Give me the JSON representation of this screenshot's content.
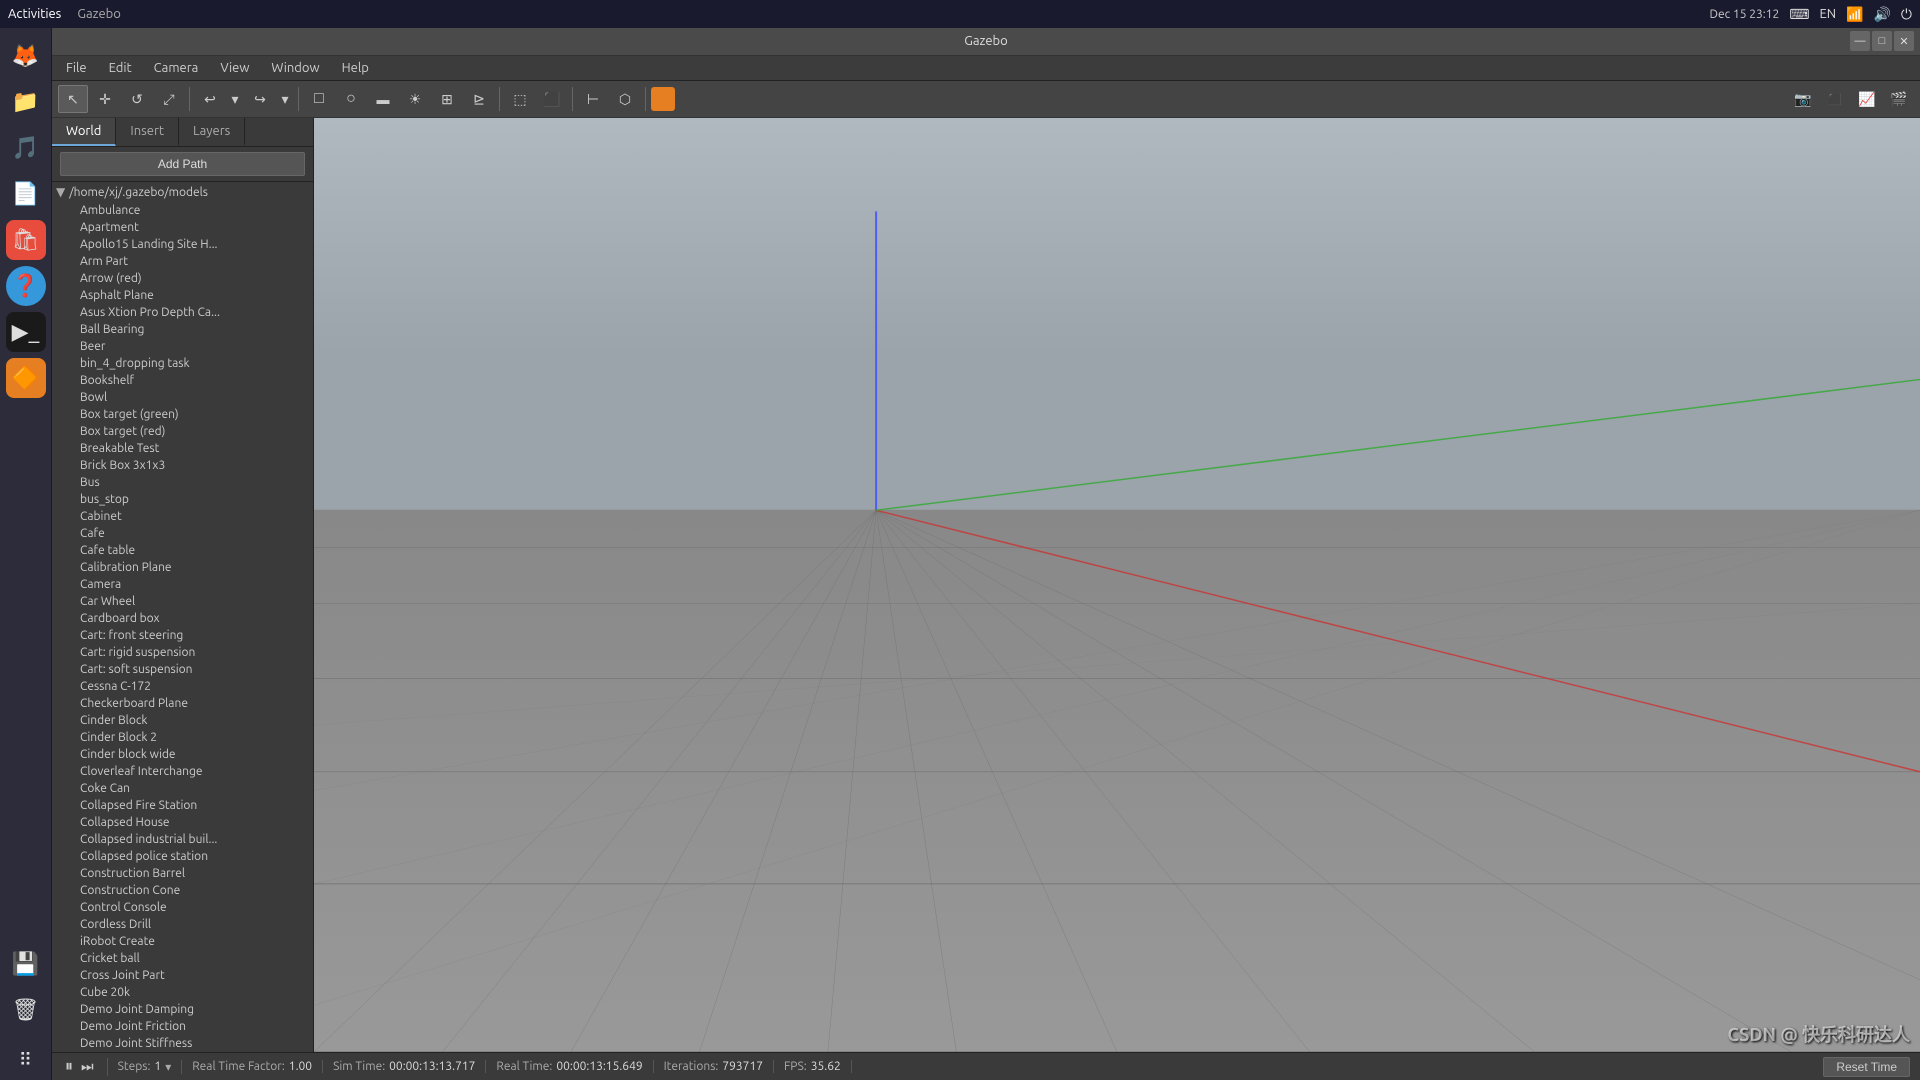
{
  "sysbar": {
    "activities": "Activities",
    "app_name": "Gazebo",
    "datetime": "Dec 15  23:12",
    "icons": [
      "keyboard-icon",
      "language-icon",
      "network-icon",
      "volume-icon",
      "power-icon"
    ]
  },
  "dock": {
    "items": [
      {
        "name": "firefox-icon",
        "symbol": "🦊",
        "label": "Firefox"
      },
      {
        "name": "files-icon",
        "symbol": "📁",
        "label": "Files"
      },
      {
        "name": "rhythmbox-icon",
        "symbol": "🎵",
        "label": "Rhythmbox"
      },
      {
        "name": "libreoffice-icon",
        "symbol": "📄",
        "label": "LibreOffice"
      },
      {
        "name": "appstore-icon",
        "symbol": "🛍",
        "label": "App Store"
      },
      {
        "name": "help-icon",
        "symbol": "❓",
        "label": "Help"
      },
      {
        "name": "terminal-icon",
        "symbol": "⬛",
        "label": "Terminal"
      },
      {
        "name": "gazebo-icon",
        "symbol": "🔶",
        "label": "Gazebo"
      },
      {
        "name": "apps-grid-icon",
        "symbol": "⠿",
        "label": "Show Apps"
      },
      {
        "name": "ssd-icon",
        "symbol": "💾",
        "label": "SSD"
      },
      {
        "name": "trash-icon",
        "symbol": "🗑",
        "label": "Trash"
      }
    ]
  },
  "window": {
    "title": "Gazebo",
    "controls": {
      "minimize": "—",
      "maximize": "□",
      "close": "✕"
    }
  },
  "menubar": {
    "items": [
      "File",
      "Edit",
      "Camera",
      "View",
      "Window",
      "Help"
    ]
  },
  "toolbar": {
    "tools": [
      {
        "name": "select-tool",
        "symbol": "↖",
        "tooltip": "Select mode"
      },
      {
        "name": "translate-tool",
        "symbol": "✛",
        "tooltip": "Translate mode"
      },
      {
        "name": "rotate-tool",
        "symbol": "↺",
        "tooltip": "Rotate mode"
      },
      {
        "name": "scale-tool",
        "symbol": "⤢",
        "tooltip": "Scale mode"
      },
      {
        "name": "sep1",
        "type": "separator"
      },
      {
        "name": "undo-tool",
        "symbol": "↩",
        "tooltip": "Undo"
      },
      {
        "name": "undo-dropdown",
        "symbol": "▾",
        "tooltip": "Undo dropdown"
      },
      {
        "name": "redo-tool",
        "symbol": "↪",
        "tooltip": "Redo"
      },
      {
        "name": "redo-dropdown",
        "symbol": "▾",
        "tooltip": "Redo dropdown"
      },
      {
        "name": "sep2",
        "type": "separator"
      },
      {
        "name": "box-tool",
        "symbol": "□",
        "tooltip": "Box"
      },
      {
        "name": "sphere-tool",
        "symbol": "○",
        "tooltip": "Sphere"
      },
      {
        "name": "cylinder-tool",
        "symbol": "▭",
        "tooltip": "Cylinder"
      },
      {
        "name": "light-tool",
        "symbol": "☀",
        "tooltip": "Light"
      },
      {
        "name": "grid-tool",
        "symbol": "⊞",
        "tooltip": "Grid"
      },
      {
        "name": "measure-tool",
        "symbol": "⊵",
        "tooltip": "Measure"
      },
      {
        "name": "sep3",
        "type": "separator"
      },
      {
        "name": "reset-tool",
        "symbol": "⬚",
        "tooltip": "Reset"
      },
      {
        "name": "snap-tool",
        "symbol": "⬛",
        "tooltip": "Snap"
      },
      {
        "name": "sep4",
        "type": "separator"
      },
      {
        "name": "align-tool",
        "symbol": "⊢",
        "tooltip": "Align"
      },
      {
        "name": "joint-tool",
        "symbol": "⬡",
        "tooltip": "Joint"
      },
      {
        "name": "sep5",
        "type": "separator"
      },
      {
        "name": "color-tool",
        "symbol": "🟧",
        "tooltip": "Color"
      }
    ],
    "right_tools": [
      {
        "name": "screenshot-tool",
        "symbol": "📷",
        "tooltip": "Screenshot"
      },
      {
        "name": "logging-tool",
        "symbol": "⬛",
        "tooltip": "Logging"
      },
      {
        "name": "plot-tool",
        "symbol": "📈",
        "tooltip": "Plot"
      },
      {
        "name": "video-tool",
        "symbol": "🎬",
        "tooltip": "Video"
      }
    ]
  },
  "left_panel": {
    "tabs": [
      {
        "id": "world",
        "label": "World",
        "active": true
      },
      {
        "id": "insert",
        "label": "Insert"
      },
      {
        "id": "layers",
        "label": "Layers"
      }
    ],
    "add_path_label": "Add Path",
    "tree": {
      "root": "/home/xj/.gazebo/models",
      "items": [
        "Ambulance",
        "Apartment",
        "Apollo15 Landing Site H...",
        "Arm Part",
        "Arrow (red)",
        "Asphalt Plane",
        "Asus Xtion Pro Depth Ca...",
        "Ball Bearing",
        "Beer",
        "bin_4_dropping task",
        "Bookshelf",
        "Bowl",
        "Box target (green)",
        "Box target (red)",
        "Breakable Test",
        "Brick Box 3x1x3",
        "Bus",
        "bus_stop",
        "Cabinet",
        "Cafe",
        "Cafe table",
        "Calibration Plane",
        "Camera",
        "Car Wheel",
        "Cardboard box",
        "Cart: front steering",
        "Cart: rigid suspension",
        "Cart: soft suspension",
        "Cessna C-172",
        "Checkerboard Plane",
        "Cinder Block",
        "Cinder Block 2",
        "Cinder block wide",
        "Cloverleaf Interchange",
        "Coke Can",
        "Collapsed Fire Station",
        "Collapsed House",
        "Collapsed industrial buil...",
        "Collapsed police station",
        "Construction Barrel",
        "Construction Cone",
        "Control Console",
        "Cordless Drill",
        "iRobot Create",
        "Cricket ball",
        "Cross Joint Part",
        "Cube 20k",
        "Demo Joint Damping",
        "Demo Joint Friction",
        "Demo Joint Stiffness"
      ]
    }
  },
  "viewport": {
    "background_color": "#888888",
    "grid_color": "#666666",
    "axis_colors": {
      "x": "#aa3333",
      "y": "#33aa33",
      "z": "#3333aa"
    }
  },
  "statusbar": {
    "pause_symbol": "⏸",
    "step_symbol": "⏭",
    "steps_label": "Steps:",
    "steps_value": "1",
    "steps_dropdown": "▾",
    "real_time_factor_label": "Real Time Factor:",
    "real_time_factor_value": "1.00",
    "sim_time_label": "Sim Time:",
    "sim_time_value": "00:00:13:13.717",
    "real_time_label": "Real Time:",
    "real_time_value": "00:00:13:15.649",
    "iterations_label": "Iterations:",
    "iterations_value": "793717",
    "fps_label": "FPS:",
    "fps_value": "35.62",
    "reset_time_label": "Reset Time"
  },
  "watermark": "CSDN @ 快乐科研达人"
}
